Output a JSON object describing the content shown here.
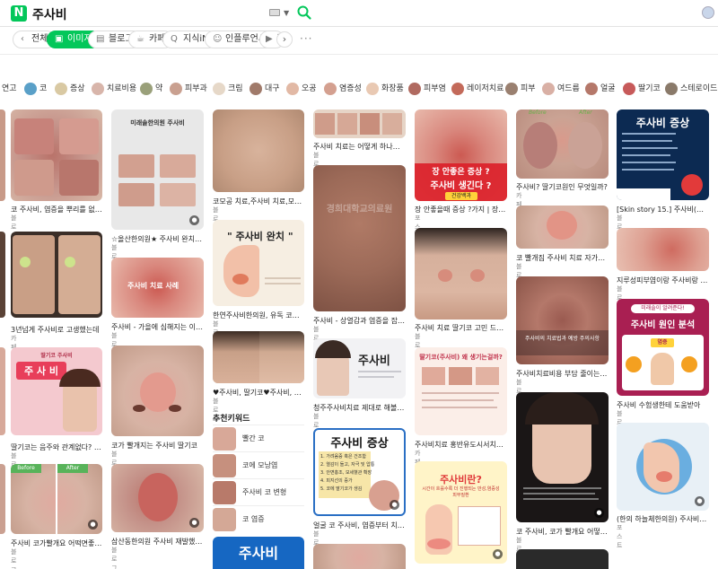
{
  "header": {
    "logo": "N",
    "query": "주사비"
  },
  "tabs": [
    {
      "label": "전체",
      "icon": "chevron-left-icon",
      "glyph": "‹"
    },
    {
      "label": "이미지",
      "icon": "image-icon",
      "glyph": "▣"
    },
    {
      "label": "블로그",
      "icon": "blog-icon",
      "glyph": "▤"
    },
    {
      "label": "카페",
      "icon": "cafe-icon",
      "glyph": "☕"
    },
    {
      "label": "지식iN",
      "icon": "kin-icon",
      "glyph": "Q"
    },
    {
      "label": "인플루언서",
      "icon": "influencer-icon",
      "glyph": "☺"
    },
    {
      "label": "동",
      "icon": "video-icon",
      "glyph": "▶"
    }
  ],
  "chips": [
    {
      "label": "연고",
      "color": ""
    },
    {
      "label": "코",
      "color": "#5aa0c8"
    },
    {
      "label": "증상",
      "color": "#d9c9a3"
    },
    {
      "label": "치료비용",
      "color": "#d8b5aa"
    },
    {
      "label": "약",
      "color": "#9aa07a"
    },
    {
      "label": "피부과",
      "color": "#c9a090"
    },
    {
      "label": "크림",
      "color": "#e6d8c8"
    },
    {
      "label": "대구",
      "color": "#a07a6a"
    },
    {
      "label": "오공",
      "color": "#e2b9a5"
    },
    {
      "label": "염증성",
      "color": "#d4a090"
    },
    {
      "label": "화장품",
      "color": "#e9c9b3"
    },
    {
      "label": "피부염",
      "color": "#b06a60"
    },
    {
      "label": "레이저치료",
      "color": "#c36a5a"
    },
    {
      "label": "피부",
      "color": "#9a8070"
    },
    {
      "label": "여드름",
      "color": "#d9b0a5"
    },
    {
      "label": "얼굴",
      "color": "#b5786a"
    },
    {
      "label": "딸기코",
      "color": "#c75a5a"
    },
    {
      "label": "스테로이드",
      "color": "#8a7a6a"
    }
  ],
  "cards": {
    "c1_1": {
      "title": "코 주사비, 염증을 뿌리를 없애라",
      "src": "블로그"
    },
    "c1_2": {
      "title": "3년넘게 주사비로 고생했는데",
      "src": "카페"
    },
    "c1_3": {
      "title": "딸기코는 음주와 관계없다? 홍대입..",
      "src": "블로그",
      "poster": "주 사 비",
      "tag": "딸기코 주사비"
    },
    "c1_4": {
      "title": "주사비 코가빨개요 어떡면좋죠?",
      "src": "블로그",
      "before": "Before",
      "after": "After"
    },
    "c2_1": {
      "title": "☆올산한의원★ 주사비 완치 ? 미..",
      "src": "블로그",
      "poster": "미래솔한의원 주사비"
    },
    "c2_2": {
      "title": "주사비 - 가을에 심해지는 이유??",
      "src": "블로그",
      "overlay": "주사비 치료 사례"
    },
    "c2_3": {
      "title": "코가 빨개지는 주사비 딸기코",
      "src": "블로그"
    },
    "c2_4": {
      "title": "삼산동한의원 주사비 재발했다면 ..",
      "src": "블로그"
    },
    "c3_1": {
      "title": "코모공 치료,주사비 치료,모공치료..",
      "src": "블로그"
    },
    "c3_2": {
      "title": "한연주사비한의원, 유독 코만 빨개..",
      "src": "블로그",
      "poster": "\" 주사비 완치 \""
    },
    "c3_3": {
      "title": "♥주사비, 딸기코♥주사비, 주사, 치..",
      "src": "블로그"
    },
    "c3_4": {
      "poster": "주사비"
    },
    "c4_1": {
      "title": "주사비 치료는 어떻게 하나요? [화..",
      "src": "블로그"
    },
    "c4_2": {
      "title": "주사비 - 상열감과 염증을 잡아라",
      "src": "블로그",
      "watermark": "경희대학교의료원"
    },
    "c4_3": {
      "title": "청주주사비치료 제대로 해볼까요?",
      "src": "블로그",
      "poster": "주사비"
    },
    "c4_4": {
      "title": "얼굴 코 주사비, 염증부터 치료하라",
      "src": "블로그",
      "poster": "주사비 증상",
      "lines": [
        "1. 가려움증 혹은 건조함",
        "2. 열감이 들고, 자극 및 압통",
        "3. 안면홍조, 모세혈관 확장",
        "4. 피지선의 증가",
        "5. 코에 딸기코가 생김"
      ]
    },
    "c5_1": {
      "title": "장 안좋을때 증상 ?가지 | 장 안좋..",
      "src": "포스트",
      "poster": "장 안좋은 증상 ?",
      "poster2": "주사비 생긴다 ?",
      "tag": "건강백과"
    },
    "c5_2": {
      "title": "주사비 치료 딸기코 고민 드디어 해..",
      "src": "블로그"
    },
    "c5_3": {
      "title": "주사비치료 홍반유도시서치파피..",
      "src": "카페",
      "poster": "딸기코(주사비) 왜 생기는걸까?"
    },
    "c5_4": {
      "poster": "주사비란?",
      "sub": "시간이 흐를수록 더 진행되는 만성,염증성 피부질환"
    },
    "c6_1": {
      "title": "주사비? 딸기코원인 무엇일까?",
      "src": "카페",
      "before": "Before",
      "after": "After"
    },
    "c6_2": {
      "title": "코 빨개짐 주사비 치료 자가진단으..",
      "src": "블로그"
    },
    "c6_3": {
      "title": "주사비치료비용 부담 줄이는 빠른 ..",
      "src": "블로그",
      "overlay": "주사비의 치료법과 예방 주의사항"
    },
    "c6_4": {
      "title": "코 주사비, 코가 빨개요 어떻게 해..",
      "src": "블로그"
    },
    "c7_1": {
      "title": "[Skin story 15.] 주사비(딸기코)",
      "src": "블로그",
      "poster": "주사비 증상"
    },
    "c7_2": {
      "title": "지루성피부염이랑 주사비랑 차이는?",
      "src": "블로그"
    },
    "c7_3": {
      "title": "주사비 수험생한테 도움받아",
      "src": "블로그",
      "poster": "주사비 원인 분석",
      "tag": "미래솔이 알려준다!",
      "badge": "염증"
    },
    "c7_4": {
      "title": "(한의 하늘체한의원) 주사비(딸기코..",
      "src": "포스트"
    }
  },
  "keywords": {
    "title": "추천키워드",
    "items": [
      {
        "label": "빨간 코"
      },
      {
        "label": "코에 모낭염"
      },
      {
        "label": "주사비 코 변형"
      },
      {
        "label": "코 염증"
      }
    ]
  }
}
